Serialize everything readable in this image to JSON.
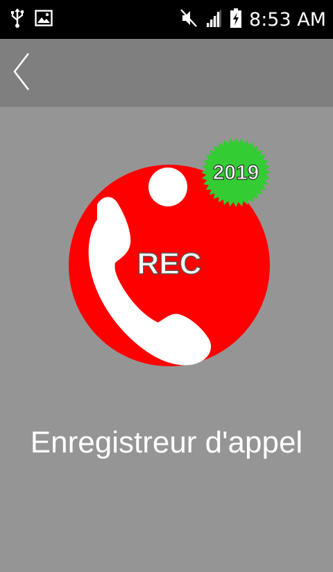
{
  "status_bar": {
    "time": "8:53 AM",
    "icons": [
      "usb-icon",
      "image-icon",
      "mute-icon",
      "signal-icon",
      "battery-charging-icon"
    ]
  },
  "app_bar": {
    "back_icon": "back-chevron-icon"
  },
  "logo": {
    "rec_text": "REC",
    "badge_text": "2019",
    "circle_color": "#ff0000",
    "badge_color": "#33cc33",
    "phone_color": "#ffffff"
  },
  "app_title": "Enregistreur d'appel",
  "colors": {
    "background": "#959595",
    "app_bar": "#7f7f7f",
    "status_bar": "#000000"
  }
}
